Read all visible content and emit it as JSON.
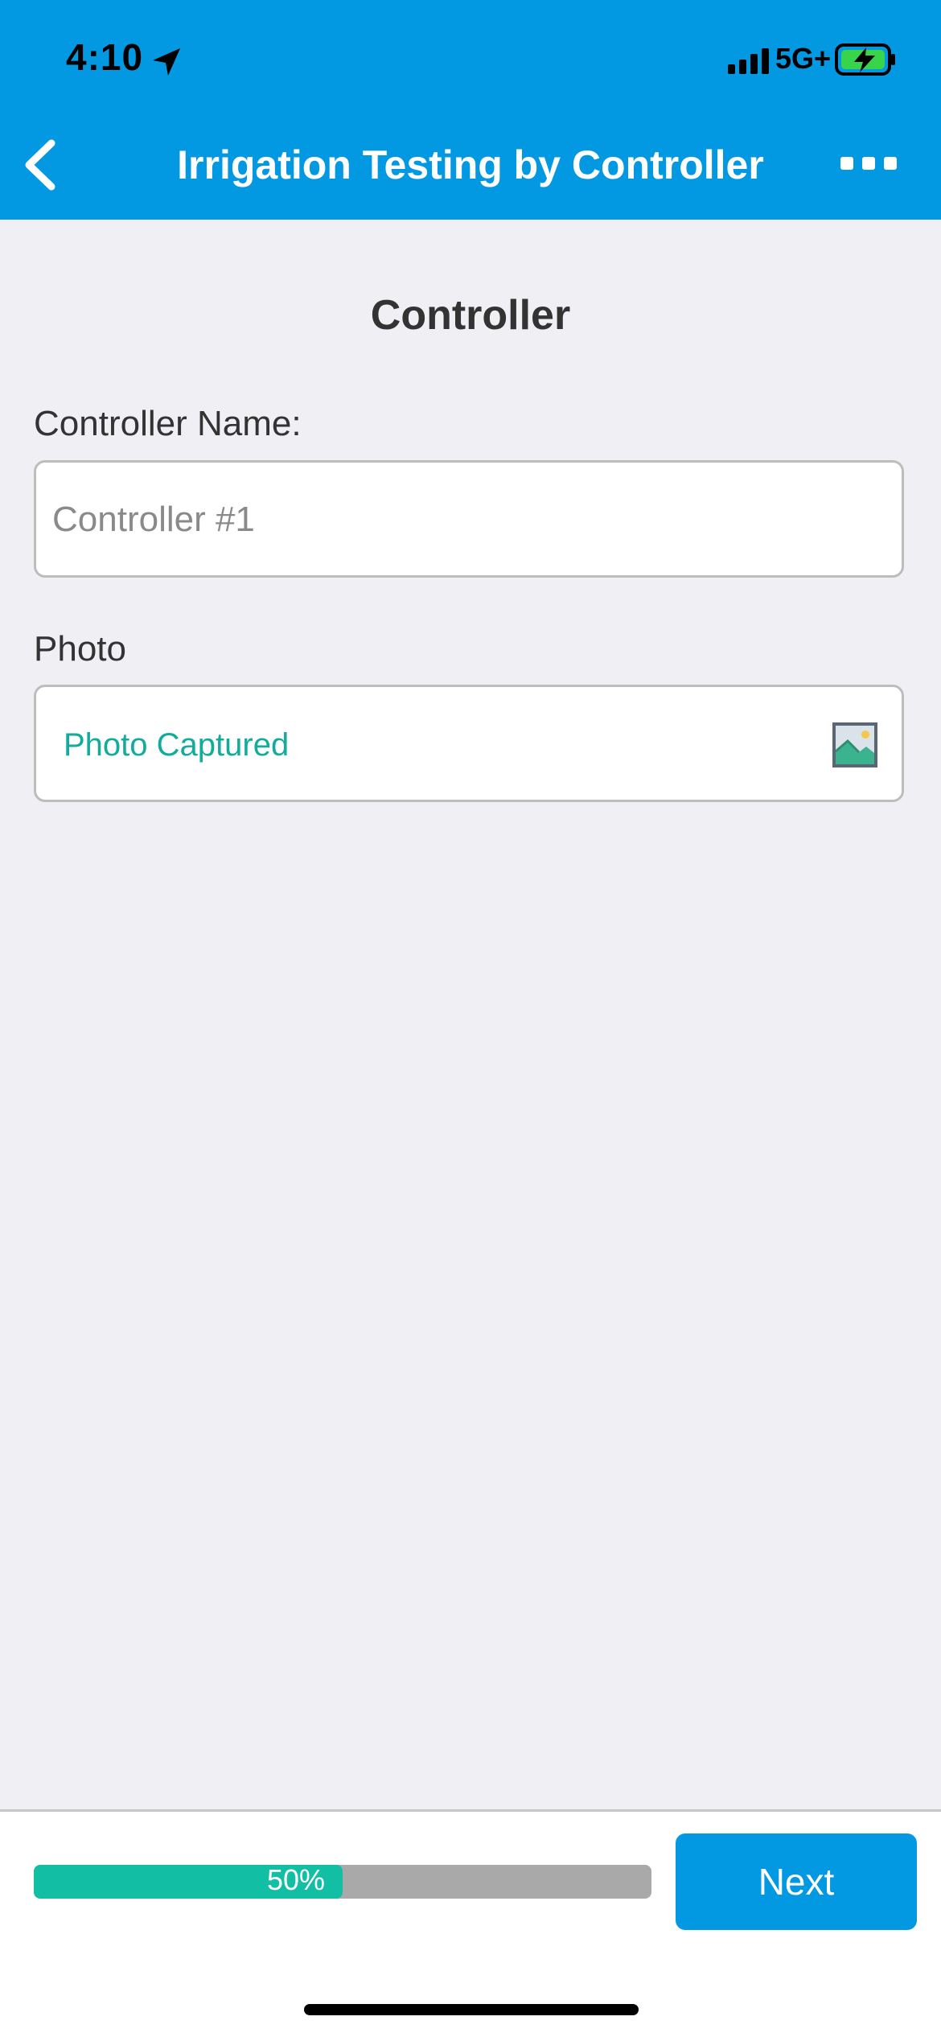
{
  "status_bar": {
    "time": "4:10",
    "network": "5G+",
    "icons": [
      "location-arrow-icon",
      "signal-bars-icon",
      "battery-charging-icon"
    ]
  },
  "nav": {
    "title": "Irrigation Testing by Controller",
    "back_icon": "chevron-left-icon",
    "more_icon": "more-dots-icon"
  },
  "form": {
    "section_title": "Controller",
    "controller_name_label": "Controller Name:",
    "controller_name_placeholder": "Controller #1",
    "photo_label": "Photo",
    "photo_status": "Photo Captured",
    "photo_icon": "image-icon"
  },
  "footer": {
    "progress_value": 50,
    "progress_text": "50%",
    "next_label": "Next"
  },
  "colors": {
    "primary": "#0399e2",
    "success": "#12bfa4",
    "background": "#efeff4"
  }
}
